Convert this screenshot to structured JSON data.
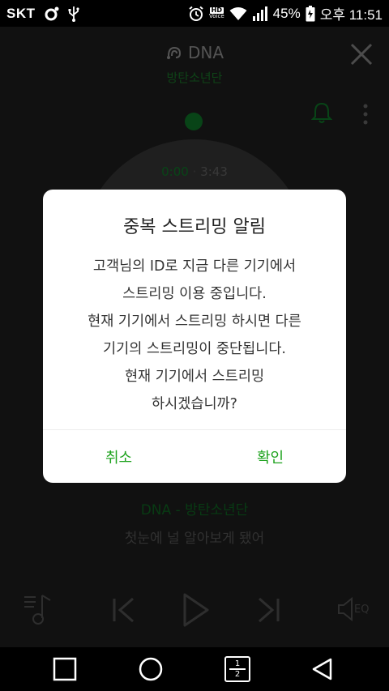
{
  "status_bar": {
    "carrier": "SKT",
    "hd_label": "HD",
    "voice_label": "Voice",
    "battery": "45%",
    "time": "오후 11:51",
    "icons": [
      "circle-notification-icon",
      "usb-icon",
      "alarm-icon",
      "wifi-icon",
      "signal-icon",
      "battery-icon"
    ]
  },
  "player": {
    "song_title": "DNA",
    "artist": "방탄소년단",
    "time_current": "0:00",
    "time_separator": "·",
    "time_total": "3:43",
    "now_playing": "DNA - 방탄소년단",
    "lyric": "첫눈에 널 알아보게 됐어",
    "eq_label": "EQ",
    "accent_color": "#1ea21e"
  },
  "dialog": {
    "title": "중복 스트리밍 알림",
    "body_lines": [
      "고객님의 ID로 지금 다른 기기에서",
      "스트리밍 이용 중입니다.",
      "현재 기기에서 스트리밍 하시면 다른",
      "기기의 스트리밍이 중단됩니다.",
      "현재 기기에서 스트리밍",
      "하시겠습니까?"
    ],
    "cancel_label": "취소",
    "confirm_label": "확인"
  },
  "nav_bar": {
    "recent_page_top": "1",
    "recent_page_bottom": "2"
  }
}
